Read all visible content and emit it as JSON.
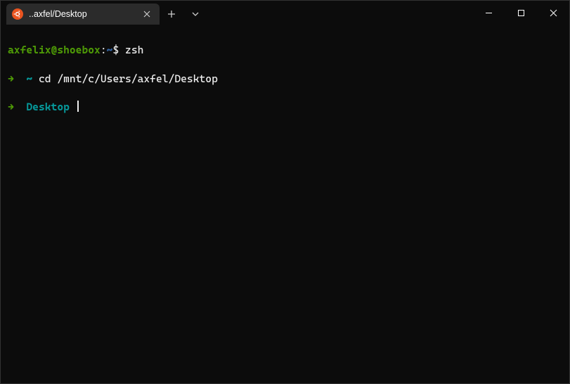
{
  "tab": {
    "title": "..axfel/Desktop",
    "icon_name": "ubuntu-icon"
  },
  "terminal": {
    "line1": {
      "user_host": "axfelix@shoebox",
      "separator": ":",
      "cwd": "~",
      "prompt_suffix": "$",
      "command": "zsh"
    },
    "line2": {
      "arrow": "→",
      "tilde": "~",
      "command": "cd /mnt/c/Users/axfel/Desktop"
    },
    "line3": {
      "arrow": "→",
      "cwd": "Desktop"
    }
  }
}
